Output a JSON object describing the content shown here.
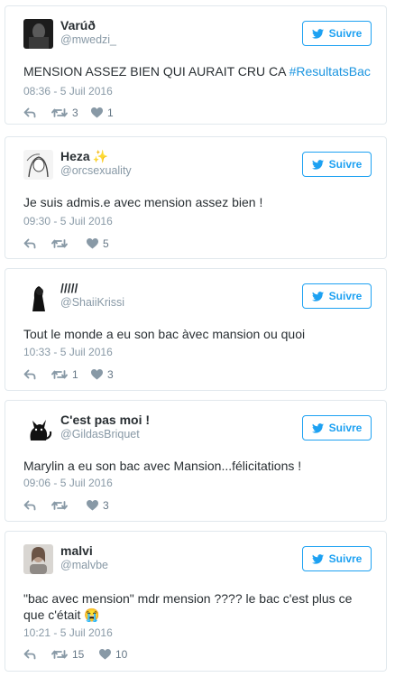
{
  "colors": {
    "accent": "#1da1f2",
    "hashtag": "#1b95e0",
    "muted": "#8899a6",
    "border": "#e1e8ed",
    "text": "#292f33"
  },
  "follow_label": "Suivre",
  "tweets": [
    {
      "name": "Varúð",
      "name_emoji": "",
      "handle": "@mwedzi_",
      "text": "MENSION ASSEZ BIEN QUI AURAIT CRU CA ",
      "hashtag": "#ResultatsBac",
      "text2": "",
      "timestamp": "08:36 - 5 Juil 2016",
      "retweets": "3",
      "likes": "1",
      "avatar_icon": "avatar-dark-photo-icon"
    },
    {
      "name": "Heza",
      "name_emoji": "✨",
      "handle": "@orcsexuality",
      "text": "Je suis admis.e avec mension assez bien !",
      "hashtag": "",
      "text2": "",
      "timestamp": "09:30 - 5 Juil 2016",
      "retweets": "",
      "likes": "5",
      "avatar_icon": "avatar-drawing-icon"
    },
    {
      "name": "/////",
      "name_emoji": "",
      "handle": "@ShaiiKrissi",
      "text": "Tout le monde a eu son bac àvec mansion ou quoi",
      "hashtag": "",
      "text2": "",
      "timestamp": "10:33 - 5 Juil 2016",
      "retweets": "1",
      "likes": "3",
      "avatar_icon": "avatar-silhouette-icon"
    },
    {
      "name": "C'est pas moi !",
      "name_emoji": "",
      "handle": "@GildasBriquet",
      "text": "Marylin a eu son bac avec Mansion...félicitations !",
      "hashtag": "",
      "text2": "",
      "timestamp": "09:06 - 5 Juil 2016",
      "retweets": "",
      "likes": "3",
      "avatar_icon": "avatar-cat-icon"
    },
    {
      "name": "malvi",
      "name_emoji": "",
      "handle": "@malvbe",
      "text": "\"bac avec mension\" mdr mension ???? le bac c'est plus ce que c'était ",
      "hashtag": "",
      "text2": "😭",
      "timestamp": "10:21 - 5 Juil 2016",
      "retweets": "15",
      "likes": "10",
      "avatar_icon": "avatar-photo-icon"
    }
  ]
}
